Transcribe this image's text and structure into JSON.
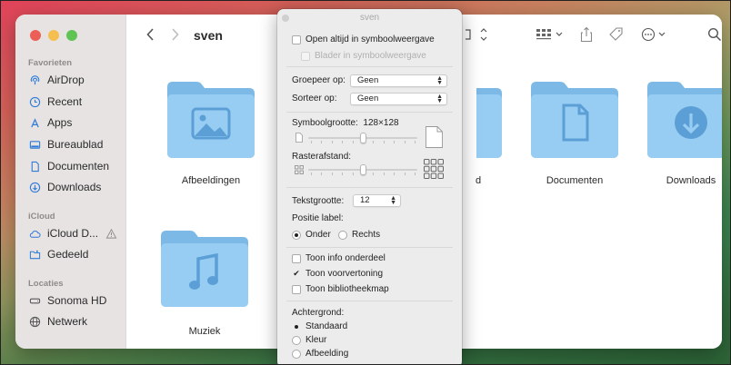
{
  "sidebar": {
    "favorites_title": "Favorieten",
    "favorites": [
      {
        "label": "AirDrop",
        "icon": "airdrop-icon"
      },
      {
        "label": "Recent",
        "icon": "clock-icon"
      },
      {
        "label": "Apps",
        "icon": "apps-icon"
      },
      {
        "label": "Bureaublad",
        "icon": "desktop-icon"
      },
      {
        "label": "Documenten",
        "icon": "document-icon"
      },
      {
        "label": "Downloads",
        "icon": "download-icon"
      }
    ],
    "icloud_title": "iCloud",
    "icloud": [
      {
        "label": "iCloud D...",
        "icon": "cloud-icon"
      },
      {
        "label": "Gedeeld",
        "icon": "shared-folder-icon"
      }
    ],
    "locations_title": "Locaties",
    "locations": [
      {
        "label": "Sonoma HD",
        "icon": "disk-icon"
      },
      {
        "label": "Netwerk",
        "icon": "globe-icon"
      }
    ]
  },
  "toolbar": {
    "title": "sven"
  },
  "folders": [
    {
      "label": "Afbeeldingen",
      "icon": "image-icon"
    },
    {
      "label": "d",
      "icon": "none"
    },
    {
      "label": "Documenten",
      "icon": "document-icon"
    },
    {
      "label": "Downloads",
      "icon": "download-icon"
    },
    {
      "label": "Muziek",
      "icon": "music-icon"
    }
  ],
  "popover": {
    "title": "sven",
    "open_always_icon": "Open altijd in symboolweergave",
    "browse_icon": "Blader in symboolweergave",
    "group_label": "Groepeer op:",
    "group_value": "Geen",
    "sort_label": "Sorteer op:",
    "sort_value": "Geen",
    "icon_size_label": "Symboolgrootte:",
    "icon_size_value": "128×128",
    "icon_size_level": 0.5,
    "grid_label": "Rasterafstand:",
    "grid_level": 0.5,
    "text_size_label": "Tekstgrootte:",
    "text_size_value": "12",
    "label_pos_title": "Positie label:",
    "label_pos_bottom": "Onder",
    "label_pos_right": "Rechts",
    "show_info": "Toon info onderdeel",
    "show_preview": "Toon voorvertoning",
    "show_library": "Toon bibliotheekmap",
    "background_title": "Achtergrond:",
    "bg_standard": "Standaard",
    "bg_color": "Kleur",
    "bg_image": "Afbeelding"
  },
  "colors": {
    "folder_light": "#97cdf3",
    "folder_dark": "#7db9e6",
    "accent": "#2f7bd8"
  }
}
